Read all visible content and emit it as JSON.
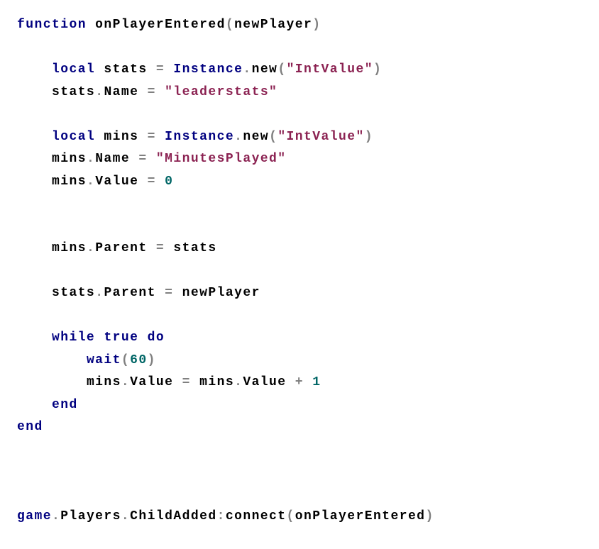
{
  "code": {
    "l1_kw_function": "function",
    "l1_name": " onPlayerEntered",
    "l1_paren_open": "(",
    "l1_param": "newPlayer",
    "l1_paren_close": ")",
    "l3_indent": "    ",
    "l3_kw_local": "local",
    "l3_var": " stats ",
    "l3_eq": "=",
    "l3_sp": " ",
    "l3_class": "Instance",
    "l3_dot": ".",
    "l3_new": "new",
    "l3_po": "(",
    "l3_str": "\"IntValue\"",
    "l3_pc": ")",
    "l4_indent": "    ",
    "l4_obj": "stats",
    "l4_dot": ".",
    "l4_prop": "Name ",
    "l4_eq": "=",
    "l4_sp": " ",
    "l4_str": "\"leaderstats\"",
    "l6_indent": "    ",
    "l6_kw_local": "local",
    "l6_var": " mins ",
    "l6_eq": "=",
    "l6_sp": " ",
    "l6_class": "Instance",
    "l6_dot": ".",
    "l6_new": "new",
    "l6_po": "(",
    "l6_str": "\"IntValue\"",
    "l6_pc": ")",
    "l7_indent": "    ",
    "l7_obj": "mins",
    "l7_dot": ".",
    "l7_prop": "Name ",
    "l7_eq": "=",
    "l7_sp": " ",
    "l7_str": "\"MinutesPlayed\"",
    "l8_indent": "    ",
    "l8_obj": "mins",
    "l8_dot": ".",
    "l8_prop": "Value ",
    "l8_eq": "=",
    "l8_sp": " ",
    "l8_num": "0",
    "l11_indent": "    ",
    "l11_obj": "mins",
    "l11_dot": ".",
    "l11_prop": "Parent ",
    "l11_eq": "=",
    "l11_sp": " ",
    "l11_val": "stats",
    "l13_indent": "    ",
    "l13_obj": "stats",
    "l13_dot": ".",
    "l13_prop": "Parent ",
    "l13_eq": "=",
    "l13_sp": " ",
    "l13_val": "newPlayer",
    "l15_indent": "    ",
    "l15_kw_while": "while",
    "l15_sp1": " ",
    "l15_kw_true": "true",
    "l15_sp2": " ",
    "l15_kw_do": "do",
    "l16_indent": "        ",
    "l16_wait": "wait",
    "l16_po": "(",
    "l16_num": "60",
    "l16_pc": ")",
    "l17_indent": "        ",
    "l17_obj1": "mins",
    "l17_dot1": ".",
    "l17_prop1": "Value ",
    "l17_eq": "=",
    "l17_sp1": " ",
    "l17_obj2": "mins",
    "l17_dot2": ".",
    "l17_prop2": "Value ",
    "l17_plus": "+",
    "l17_sp2": " ",
    "l17_num": "1",
    "l18_indent": "    ",
    "l18_end": "end",
    "l19_end": "end",
    "l23_game": "game",
    "l23_dot1": ".",
    "l23_players": "Players",
    "l23_dot2": ".",
    "l23_child": "ChildAdded",
    "l23_colon": ":",
    "l23_connect": "connect",
    "l23_po": "(",
    "l23_arg": "onPlayerEntered",
    "l23_pc": ")"
  }
}
